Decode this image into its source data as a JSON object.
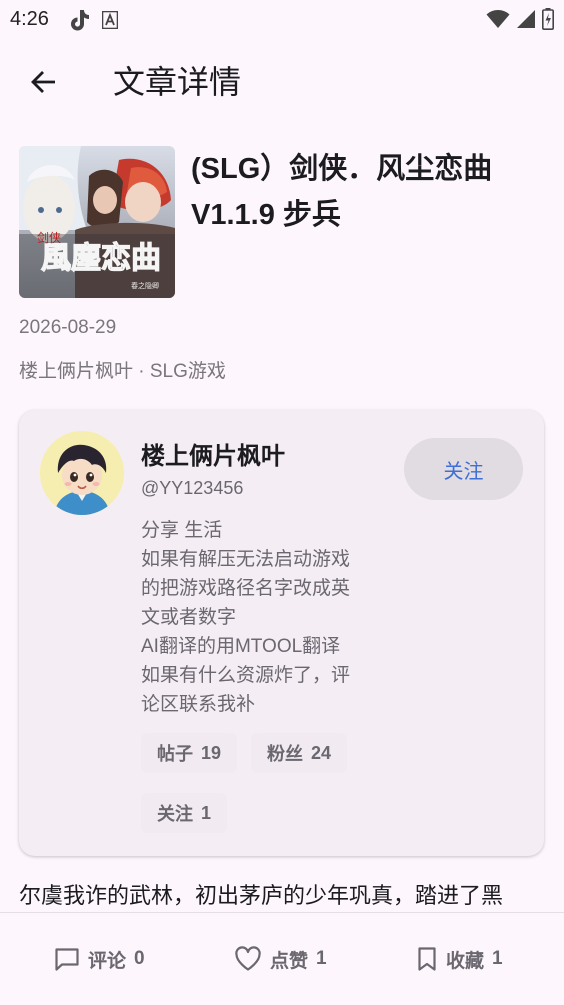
{
  "status_bar": {
    "time": "4:26",
    "icons": [
      "tiktok-icon",
      "font-a-icon",
      "wifi-icon",
      "signal-icon",
      "battery-charging-icon"
    ]
  },
  "app_bar": {
    "title": "文章详情",
    "back_icon": "arrow-left-icon"
  },
  "article": {
    "title": "(SLG）剑侠．风尘恋曲V1.1.9 步兵",
    "cover_text": "風塵恋曲",
    "cover_side_text": "剑侠",
    "cover_small_text": "春之隐卿",
    "date": "2026-08-29",
    "meta": "楼上俩片枫叶 · SLG游戏",
    "body_preview": "尔虞我诈的武林，初出茅庐的少年巩真，踏进了黑"
  },
  "author": {
    "name": "楼上俩片枫叶",
    "handle": "@YY123456",
    "follow_label": "关注",
    "bio_lines": [
      "分享 生活",
      "如果有解压无法启动游戏",
      "的把游戏路径名字改成英",
      "文或者数字",
      "AI翻译的用MTOOL翻译",
      "如果有什么资源炸了，评",
      "论区联系我补"
    ],
    "stats": [
      {
        "label": "帖子",
        "value": "19"
      },
      {
        "label": "粉丝",
        "value": "24"
      },
      {
        "label": "关注",
        "value": "1"
      }
    ]
  },
  "bottom_bar": {
    "comment": {
      "label": "评论",
      "count": "0",
      "icon": "comment-icon"
    },
    "like": {
      "label": "点赞",
      "count": "1",
      "icon": "heart-icon"
    },
    "favorite": {
      "label": "收藏",
      "count": "1",
      "icon": "bookmark-icon"
    }
  }
}
